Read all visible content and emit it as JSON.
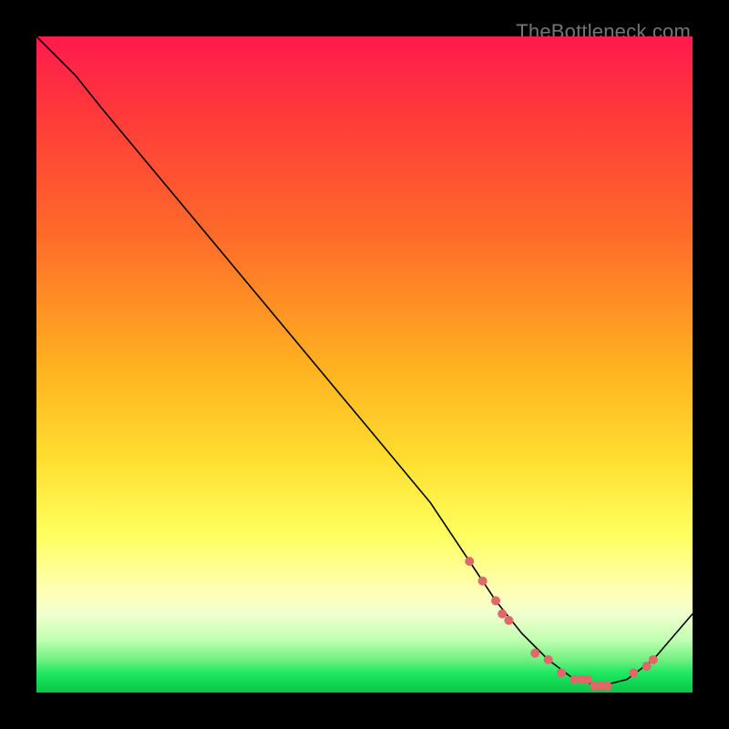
{
  "watermark": "TheBottleneck.com",
  "colors": {
    "dot": "#e06868",
    "line": "#000000"
  },
  "chart_data": {
    "type": "line",
    "title": "",
    "xlabel": "",
    "ylabel": "",
    "xlim": [
      0,
      100
    ],
    "ylim": [
      0,
      100
    ],
    "series": [
      {
        "name": "curve",
        "x": [
          0,
          6,
          10,
          20,
          30,
          40,
          50,
          60,
          66,
          70,
          74,
          78,
          82,
          86,
          90,
          94,
          100
        ],
        "y": [
          100,
          94,
          89,
          77,
          65,
          53,
          41,
          29,
          20,
          14,
          9,
          5,
          2,
          1,
          2,
          5,
          12
        ]
      }
    ],
    "markers": {
      "name": "highlight-dots",
      "x": [
        66,
        68,
        70,
        71,
        72,
        76,
        78,
        80,
        82,
        83,
        84,
        85,
        86,
        87,
        91,
        93,
        94
      ],
      "y": [
        20,
        17,
        14,
        12,
        11,
        6,
        5,
        3,
        2,
        2,
        2,
        1,
        1,
        1,
        3,
        4,
        5
      ]
    }
  }
}
